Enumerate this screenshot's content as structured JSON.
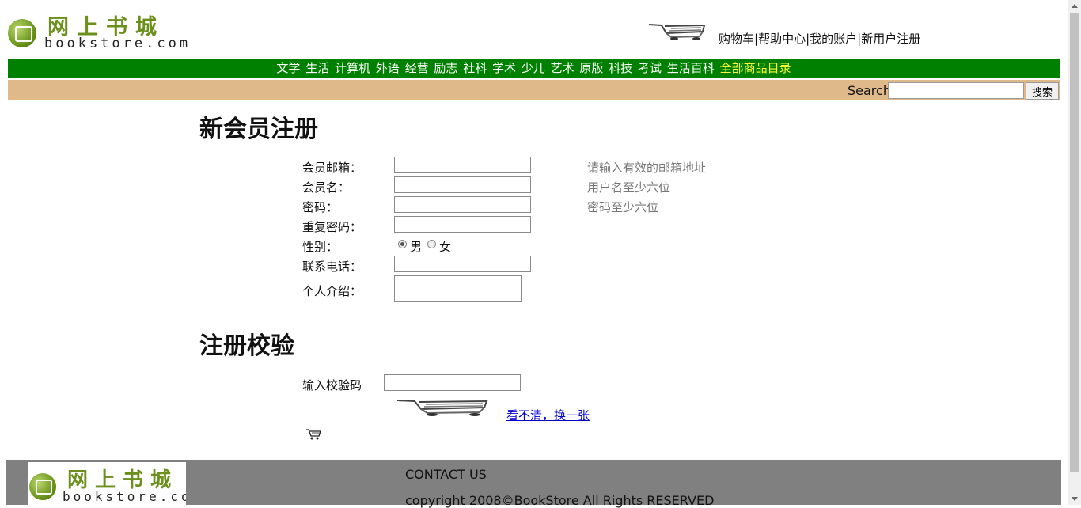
{
  "header": {
    "logo_cn": "网上书城",
    "logo_en": "bookstore.com",
    "links": [
      "购物车",
      "帮助中心",
      "我的账户",
      "新用户注册"
    ],
    "separator": "|"
  },
  "nav": {
    "items": [
      "文学",
      "生活",
      "计算机",
      "外语",
      "经营",
      "励志",
      "社科",
      "学术",
      "少儿",
      "艺术",
      "原版",
      "科技",
      "考试",
      "生活百科"
    ],
    "all_label": "全部商品目录",
    "bg_color": "#008000",
    "highlight_color": "#ffff33"
  },
  "search": {
    "label": "Search",
    "button": "搜索",
    "bar_color": "#dfb98a"
  },
  "register": {
    "title": "新会员注册",
    "email_label": "会员邮箱：",
    "email_hint": "请输入有效的邮箱地址",
    "username_label": "会员名：",
    "username_hint": "用户名至少六位",
    "password_label": "密码：",
    "password_hint": "密码至少六位",
    "repassword_label": "重复密码：",
    "gender_label": "性别：",
    "gender_male": "男",
    "gender_female": "女",
    "phone_label": "联系电话：",
    "intro_label": "个人介绍："
  },
  "verify": {
    "title": "注册校验",
    "code_label": "输入校验码",
    "refresh_link": "看不清，换一张"
  },
  "footer": {
    "logo_cn": "网上书城",
    "logo_en": "bookstore.com",
    "contact": "CONTACT US",
    "copyright": "copyright 2008©BookStore All Rights RESERVED",
    "bg_color": "#808080"
  }
}
